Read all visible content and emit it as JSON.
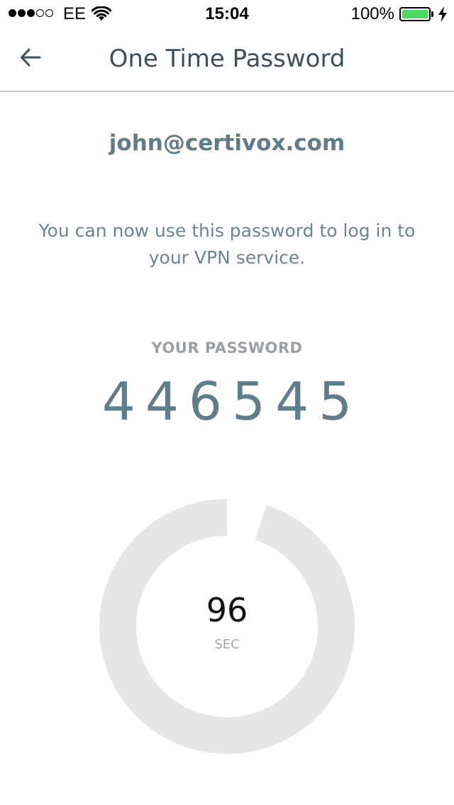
{
  "status_bar": {
    "signal_bars_filled": 3,
    "signal_bars_total": 5,
    "carrier": "EE",
    "wifi_icon": "wifi-icon",
    "time": "15:04",
    "battery_percent": "100%",
    "battery_level": 1.0,
    "charging_icon": "bolt-icon",
    "battery_color": "#4cd964"
  },
  "nav": {
    "back_icon": "arrow-left-icon",
    "title": "One Time Password"
  },
  "account": {
    "email": "john@certivox.com"
  },
  "message": "You can now use this password to log in to your VPN service.",
  "password": {
    "label": "YOUR PASSWORD",
    "value": "446545"
  },
  "countdown": {
    "value": "96",
    "unit": "SEC",
    "remaining_fraction": 0.95,
    "ring_color": "#e6e6e6"
  }
}
